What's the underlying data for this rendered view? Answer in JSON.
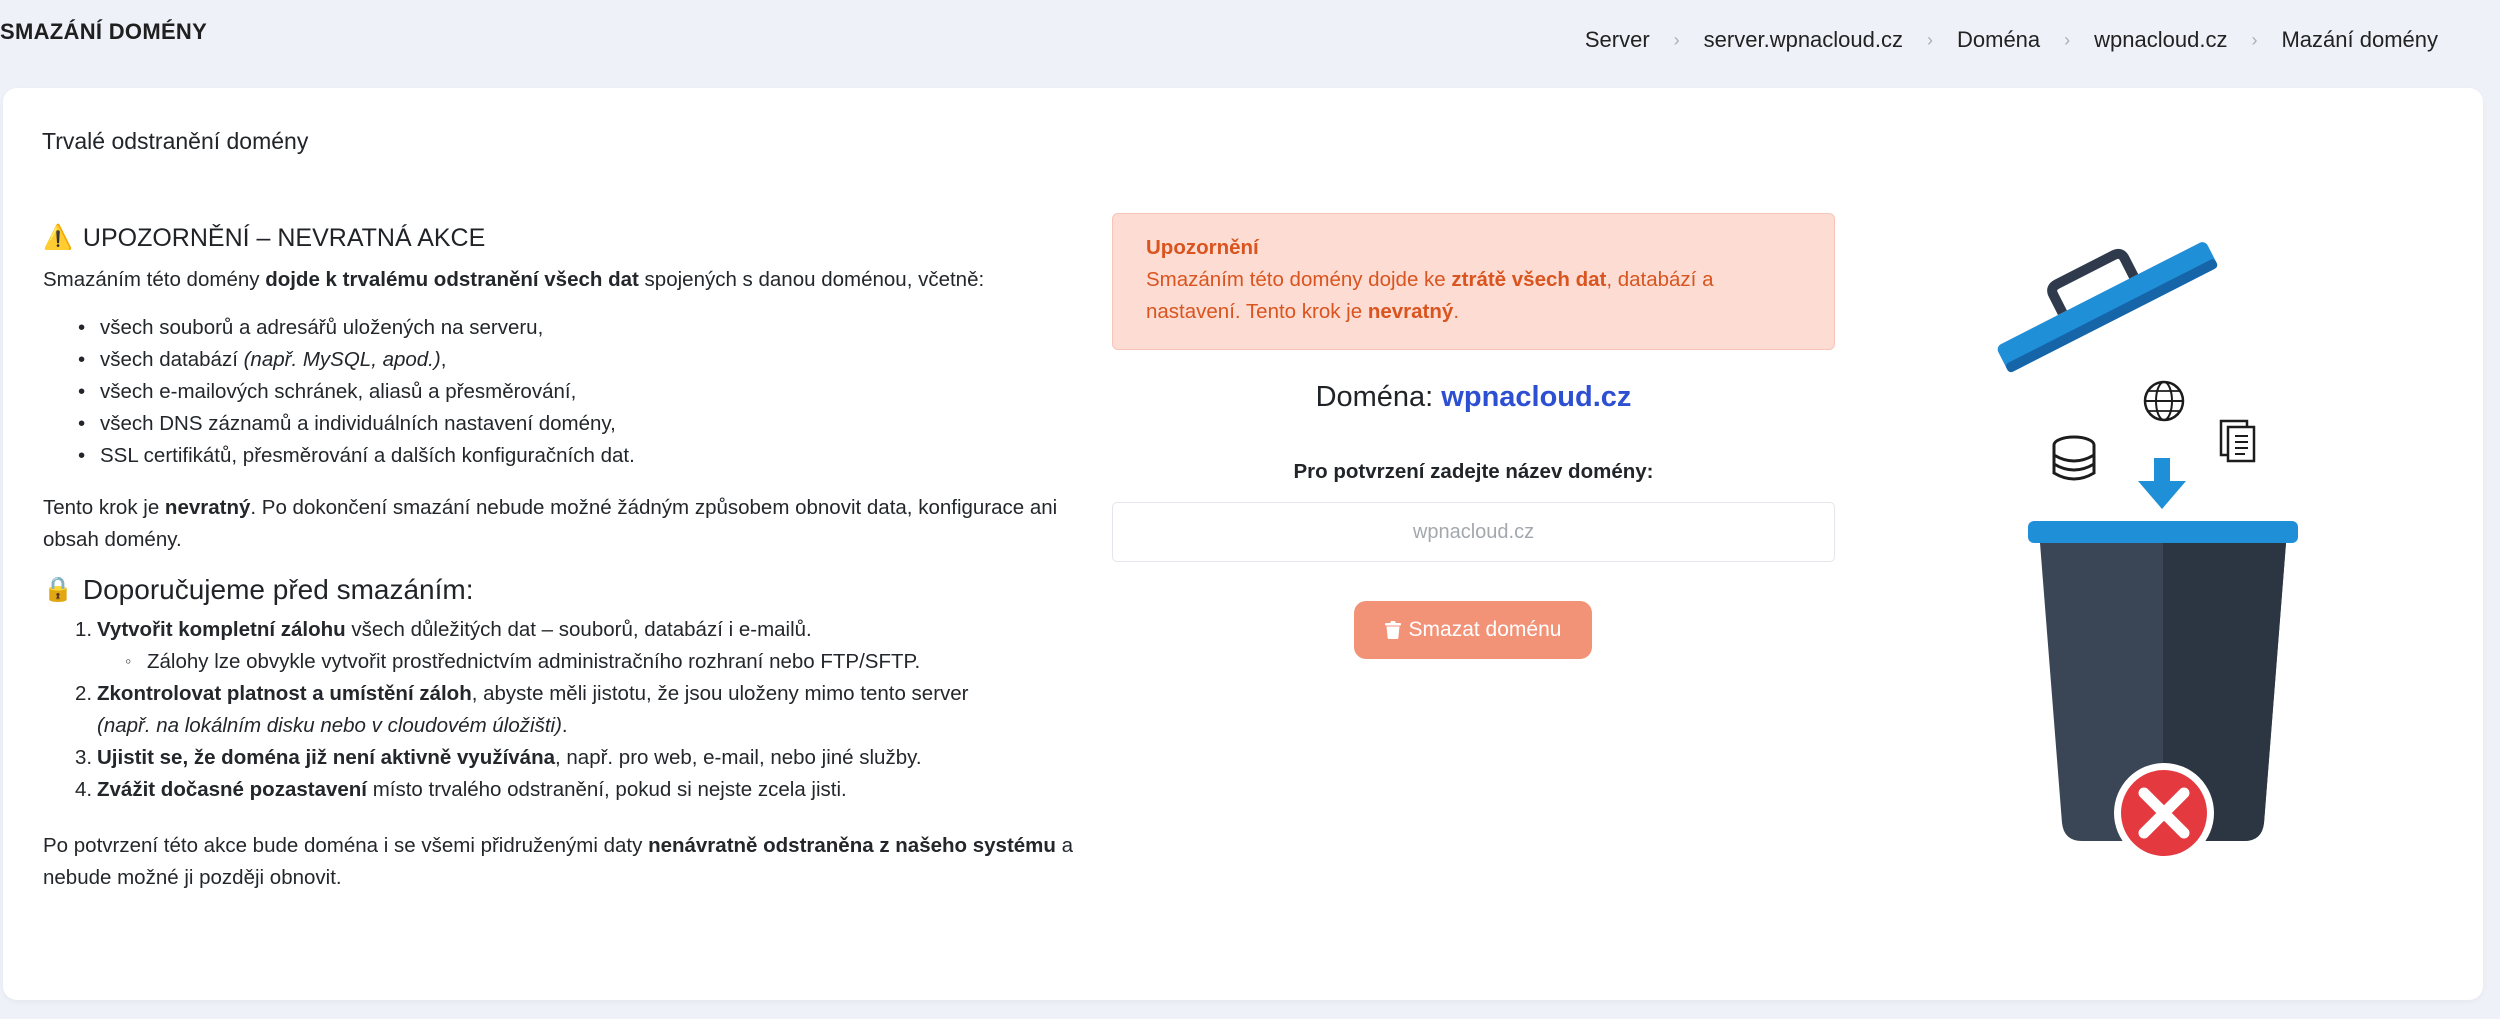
{
  "header": {
    "title": "SMAZÁNÍ DOMÉNY",
    "breadcrumb": [
      "Server",
      "server.wpnacloud.cz",
      "Doména",
      "wpnacloud.cz",
      "Mazání domény"
    ]
  },
  "card": {
    "title": "Trvalé odstranění domény"
  },
  "warning_section": {
    "icon": "warning-icon",
    "heading": "UPOZORNĚNÍ – NEVRATNÁ AKCE",
    "intro_a": "Smazáním této domény ",
    "intro_b": "dojde k trvalému odstranění všech dat",
    "intro_c": " spojených s danou doménou, včetně:",
    "items": [
      {
        "a": "všech souborů a adresářů uložených na serveru,",
        "b": ""
      },
      {
        "a": "všech databází ",
        "b": "(např. MySQL, apod.)",
        "c": ","
      },
      {
        "a": "všech e-mailových schránek, aliasů a přesměrování,",
        "b": ""
      },
      {
        "a": "všech DNS záznamů a individuálních nastavení domény,",
        "b": ""
      },
      {
        "a": "SSL certifikátů, přesměrování a dalších konfiguračních dat.",
        "b": ""
      }
    ],
    "irreversible_a": "Tento krok je ",
    "irreversible_b": "nevratný",
    "irreversible_c": ". Po dokončení smazání nebude možné žádným způsobem obnovit data, konfigurace ani obsah domény."
  },
  "recommend_section": {
    "icon": "lock-icon",
    "heading": "Doporučujeme před smazáním:",
    "items": [
      {
        "num": "1.",
        "bold": "Vytvořit kompletní zálohu",
        "rest": " všech důležitých dat – souborů, databází i e-mailů.",
        "sub": "Zálohy lze obvykle vytvořit prostřednictvím administračního rozhraní nebo FTP/SFTP."
      },
      {
        "num": "2.",
        "bold": "Zkontrolovat platnost a umístění záloh",
        "rest": ", abyste měli jistotu, že jsou uloženy mimo tento server",
        "italic": "(např. na lokálním disku nebo v cloudovém úložišti)",
        "tail": "."
      },
      {
        "num": "3.",
        "bold": "Ujistit se, že doména již není aktivně využívána",
        "rest": ", např. pro web, e-mail, nebo jiné služby."
      },
      {
        "num": "4.",
        "bold": "Zvážit dočasné pozastavení",
        "rest": " místo trvalého odstranění, pokud si nejste zcela jisti."
      }
    ],
    "final_a": "Po potvrzení této akce bude doména i se všemi přidruženými daty ",
    "final_b": "nenávratně odstraněna z našeho systému",
    "final_c": " a nebude možné ji později obnovit."
  },
  "alert": {
    "title": "Upozornění",
    "text_a": "Smazáním této domény dojde ke ",
    "text_b": "ztrátě všech dat",
    "text_c": ", databází a nastavení. Tento krok je ",
    "text_d": "nevratný",
    "text_e": "."
  },
  "domain": {
    "label": "Doména: ",
    "value": "wpnacloud.cz"
  },
  "confirm": {
    "label": "Pro potvrzení zadejte název domény:",
    "placeholder": "wpnacloud.cz",
    "value": ""
  },
  "delete_button": {
    "label": "Smazat doménu",
    "icon": "trash-icon"
  },
  "colors": {
    "accent_blue": "#2d4fd1",
    "alert_bg": "#fcdcd3",
    "alert_text": "#d9541e",
    "button_bg": "#f29378"
  }
}
